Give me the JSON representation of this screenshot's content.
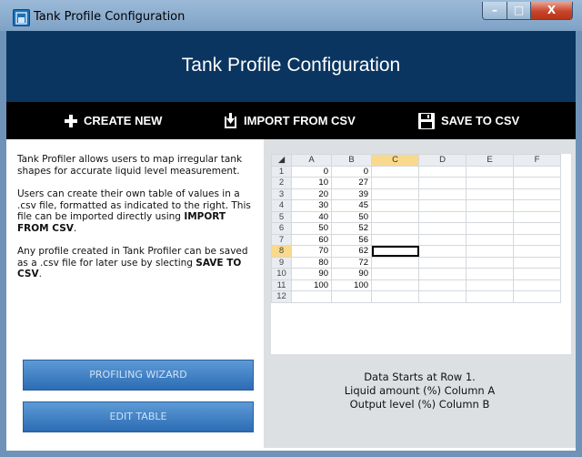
{
  "window": {
    "title": "Tank Profile Configuration",
    "caption_min": "–",
    "caption_max": "□",
    "caption_close": "X"
  },
  "header": {
    "title": "Tank Profile Configuration"
  },
  "toolbar": {
    "create_new": "CREATE NEW",
    "import_csv": "IMPORT FROM CSV",
    "save_csv": "SAVE TO CSV"
  },
  "info": {
    "p1": "Tank Profiler allows users to map irregular tank shapes for accurate liquid level measurement.",
    "p2_pre": "Users can create their own table of values in a .csv file, formatted as indicated to the right. This file can be imported directly using ",
    "p2_bold": "IMPORT FROM CSV",
    "p2_post": ".",
    "p3_pre": "Any profile created in Tank Profiler can be saved as a .csv file for later use by slecting ",
    "p3_bold": "SAVE TO CSV",
    "p3_post": "."
  },
  "buttons": {
    "profiling_wizard": "PROFILING WIZARD",
    "edit_table": "EDIT TABLE"
  },
  "sheet": {
    "columns": [
      "A",
      "B",
      "C",
      "D",
      "E",
      "F"
    ],
    "rows": [
      [
        "1",
        "0",
        "0"
      ],
      [
        "2",
        "10",
        "27"
      ],
      [
        "3",
        "20",
        "39"
      ],
      [
        "4",
        "30",
        "45"
      ],
      [
        "5",
        "40",
        "50"
      ],
      [
        "6",
        "50",
        "52"
      ],
      [
        "7",
        "60",
        "56"
      ],
      [
        "8",
        "70",
        "62"
      ],
      [
        "9",
        "80",
        "72"
      ],
      [
        "10",
        "90",
        "90"
      ],
      [
        "11",
        "100",
        "100"
      ],
      [
        "12",
        "",
        ""
      ]
    ],
    "selected_column": "C",
    "selected_row": "8"
  },
  "notes": {
    "line1": "Data Starts at Row 1.",
    "line2": "Liquid amount (%) Column A",
    "line3": "Output level (%) Column B"
  },
  "colors": {
    "header_bg": "#0a3560",
    "toolbar_bg": "#000000",
    "button_blue": "#2c6cb4",
    "selection": "#f9d98b"
  }
}
